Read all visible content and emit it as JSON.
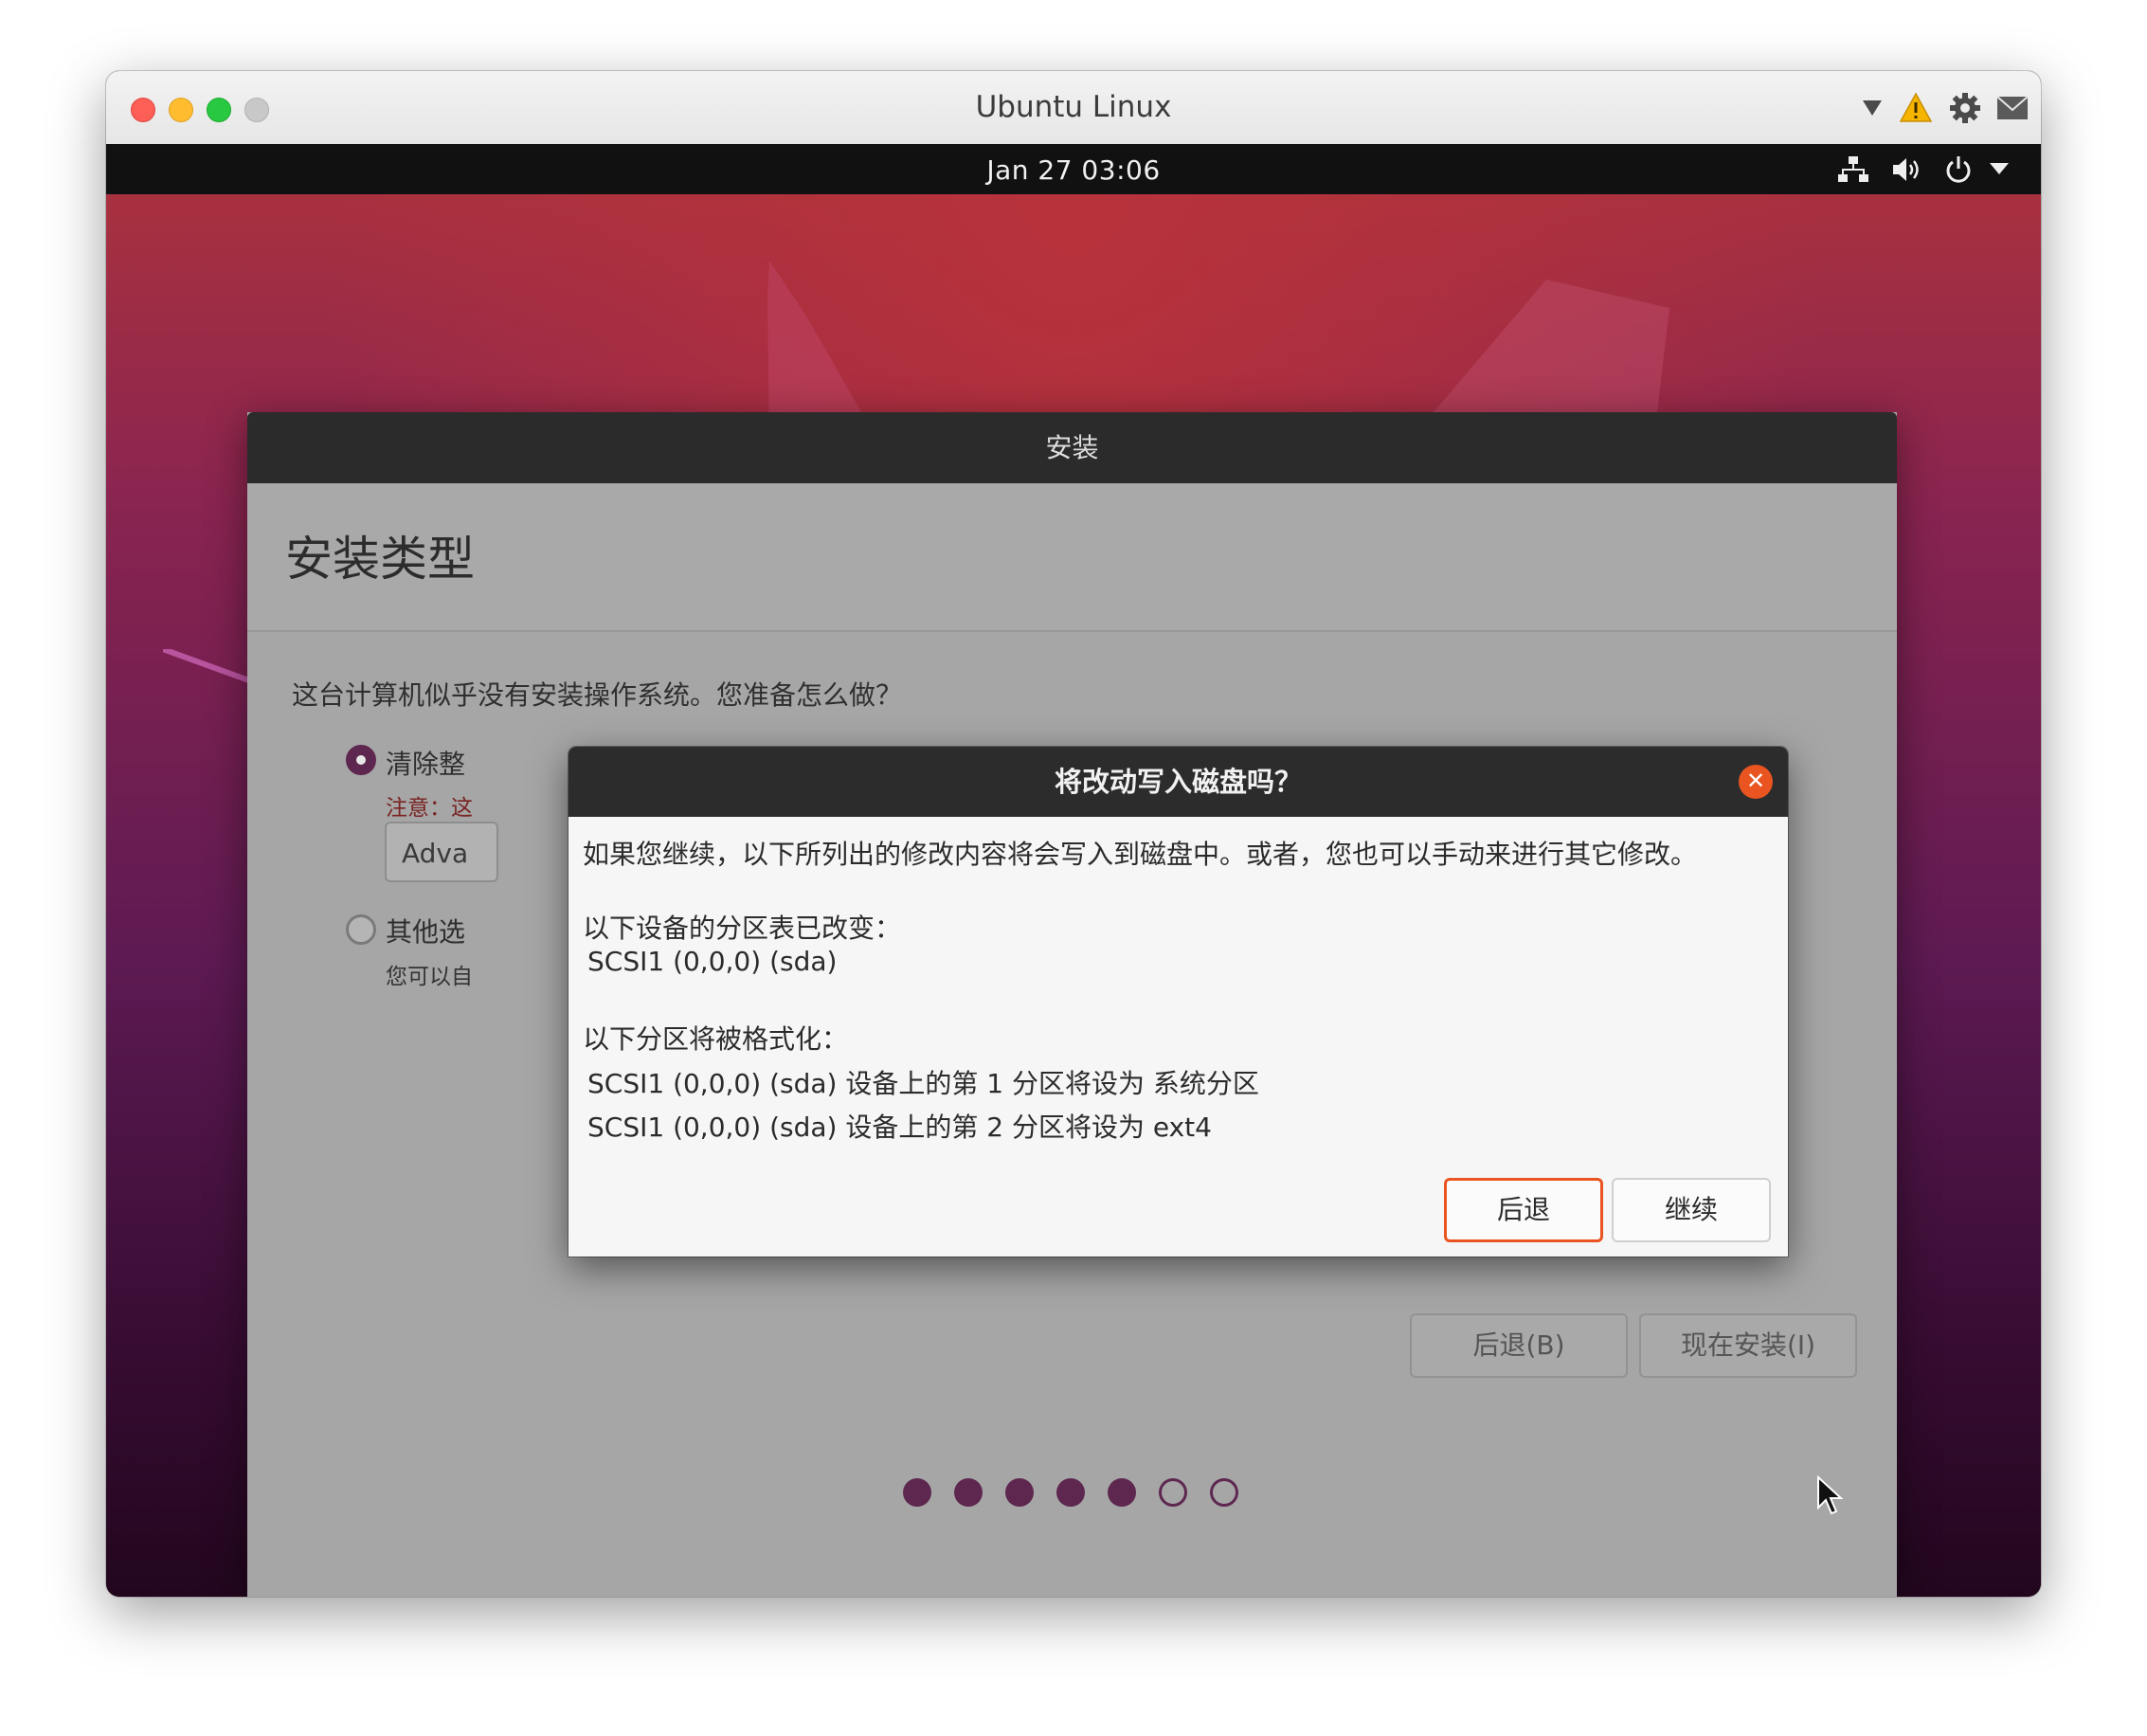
{
  "vm": {
    "window_title": "Ubuntu Linux"
  },
  "panel": {
    "clock": "Jan 27  03:06"
  },
  "installer": {
    "header_title": "安装",
    "page_title": "安装类型",
    "question": "这台计算机似乎没有安装操作系统。您准备怎么做？",
    "option1_label": "清除整",
    "option1_note": "注意：这",
    "advanced_button": "Adva",
    "option2_label": "其他选",
    "option2_sub": "您可以自",
    "back_button": "后退(B)",
    "install_button": "现在安装(I)",
    "progress": {
      "total_steps": 7,
      "completed_steps": 5
    }
  },
  "dialog": {
    "title": "将改动写入磁盘吗？",
    "intro": "如果您继续，以下所列出的修改内容将会写入到磁盘中。或者，您也可以手动来进行其它修改。",
    "partition_table_heading": "以下设备的分区表已改变：",
    "partition_table_device": "SCSI1 (0,0,0) (sda)",
    "format_heading": "以下分区将被格式化：",
    "format_item_1": "SCSI1 (0,0,0) (sda) 设备上的第 1 分区将设为 系统分区",
    "format_item_2": "SCSI1 (0,0,0) (sda) 设备上的第 2 分区将设为 ext4",
    "back_button": "后退",
    "continue_button": "继续"
  },
  "colors": {
    "ubuntu_orange": "#e95420",
    "aubergine": "#5e2750"
  },
  "icons": {
    "titlebar": [
      "dropdown-arrow-icon",
      "warning-icon",
      "gear-icon",
      "mail-icon"
    ],
    "tray": [
      "network-icon",
      "volume-icon",
      "power-icon",
      "chevron-down-icon"
    ]
  }
}
